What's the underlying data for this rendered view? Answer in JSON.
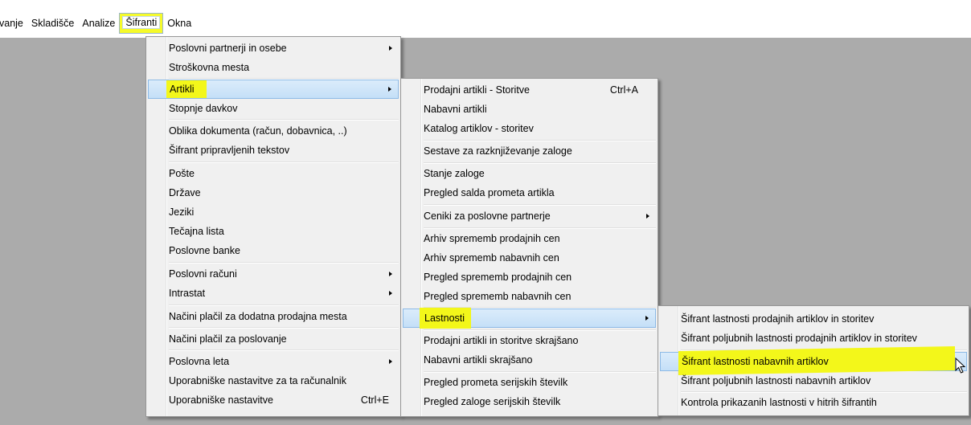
{
  "menubar": {
    "items": [
      {
        "label": "vanje"
      },
      {
        "label": "Skladišče"
      },
      {
        "label": "Analize"
      },
      {
        "label": "Šifranti"
      },
      {
        "label": "Okna"
      }
    ]
  },
  "menu_sifranti": {
    "items": [
      {
        "label": "Poslovni partnerji in osebe"
      },
      {
        "label": "Stroškovna mesta"
      },
      {
        "label": "Artikli"
      },
      {
        "label": "Stopnje davkov"
      },
      {
        "label": "Oblika dokumenta (račun, dobavnica, ..)"
      },
      {
        "label": "Šifrant pripravljenih tekstov"
      },
      {
        "label": "Pošte"
      },
      {
        "label": "Države"
      },
      {
        "label": "Jeziki"
      },
      {
        "label": "Tečajna lista"
      },
      {
        "label": "Poslovne banke"
      },
      {
        "label": "Poslovni računi"
      },
      {
        "label": "Intrastat"
      },
      {
        "label": "Načini plačil za dodatna prodajna mesta"
      },
      {
        "label": "Načini plačil za poslovanje"
      },
      {
        "label": "Poslovna leta"
      },
      {
        "label": "Uporabniške nastavitve za ta računalnik"
      },
      {
        "label": "Uporabniške nastavitve",
        "shortcut": "Ctrl+E"
      }
    ]
  },
  "menu_artikli": {
    "items": [
      {
        "label": "Prodajni artikli - Storitve",
        "shortcut": "Ctrl+A"
      },
      {
        "label": "Nabavni artikli"
      },
      {
        "label": "Katalog artiklov - storitev"
      },
      {
        "label": "Sestave za razknjiževanje zaloge"
      },
      {
        "label": "Stanje zaloge"
      },
      {
        "label": "Pregled salda prometa artikla"
      },
      {
        "label": "Ceniki za poslovne partnerje"
      },
      {
        "label": "Arhiv sprememb prodajnih cen"
      },
      {
        "label": "Arhiv sprememb nabavnih cen"
      },
      {
        "label": "Pregled sprememb prodajnih cen"
      },
      {
        "label": "Pregled sprememb nabavnih cen"
      },
      {
        "label": "Lastnosti"
      },
      {
        "label": "Prodajni artikli in storitve skrajšano"
      },
      {
        "label": "Nabavni artikli skrajšano"
      },
      {
        "label": "Pregled prometa serijskih številk"
      },
      {
        "label": "Pregled zaloge serijskih številk"
      }
    ]
  },
  "menu_lastnosti": {
    "items": [
      {
        "label": "Šifrant lastnosti prodajnih artiklov in storitev"
      },
      {
        "label": "Šifrant poljubnih lastnosti prodajnih artiklov in storitev"
      },
      {
        "label": "Šifrant lastnosti nabavnih artiklov"
      },
      {
        "label": "Šifrant poljubnih lastnosti nabavnih artiklov"
      },
      {
        "label": "Kontrola prikazanih lastnosti v hitrih šifrantih"
      }
    ]
  },
  "colors": {
    "highlight": "#f3f71a",
    "selection": "#c4dff7",
    "desktop": "#ababab",
    "menu_bg": "#f0f0f0"
  }
}
